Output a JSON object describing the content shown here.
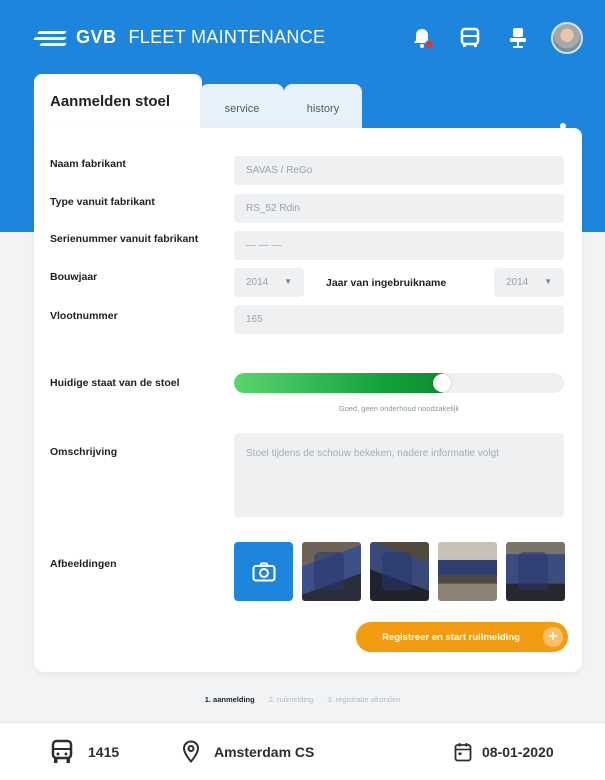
{
  "app": {
    "brand": "GVB",
    "title": "FLEET MAINTENANCE"
  },
  "header": {
    "icons": [
      "bell-icon",
      "bus-icon",
      "seat-icon",
      "avatar"
    ]
  },
  "tabs": [
    {
      "label": "Aanmelden stoel",
      "active": true
    },
    {
      "label": "service",
      "active": false
    },
    {
      "label": "history",
      "active": false
    }
  ],
  "form": {
    "manufacturer_label": "Naam fabrikant",
    "manufacturer_value": "SAVAS / ReGo",
    "type_label": "Type vanuit fabrikant",
    "type_value": "RS_52 Rdin",
    "serial_label": "Serienummer vanuit fabrikant",
    "serial_value": "— — —",
    "year_label": "Bouwjaar",
    "year_value": "2014",
    "inuse_label": "Jaar van ingebruikname",
    "inuse_value": "2014",
    "fleet_label": "Vlootnummer",
    "fleet_value": "165",
    "condition_label": "Huidige staat van de stoel",
    "condition_level": 0.65,
    "condition_text": "Goed, geen onderhoud noodzakelijk",
    "description_label": "Omschrijving",
    "description_placeholder": "Stoel tijdens de schouw bekeken, nadere informatie volgt",
    "images_label": "Afbeeldingen"
  },
  "cta": {
    "label": "Registreer en start ruilmelding"
  },
  "steps": [
    {
      "label": "1. aanmelding",
      "active": true
    },
    {
      "label": "2. ruilmelding",
      "active": false
    },
    {
      "label": "3. registratie afronden",
      "active": false
    }
  ],
  "footer": {
    "bus_number": "1415",
    "location": "Amsterdam CS",
    "date": "08-01-2020"
  },
  "colors": {
    "primary": "#1d86dc",
    "accent": "#f39c12",
    "progress": "#12a13a"
  }
}
